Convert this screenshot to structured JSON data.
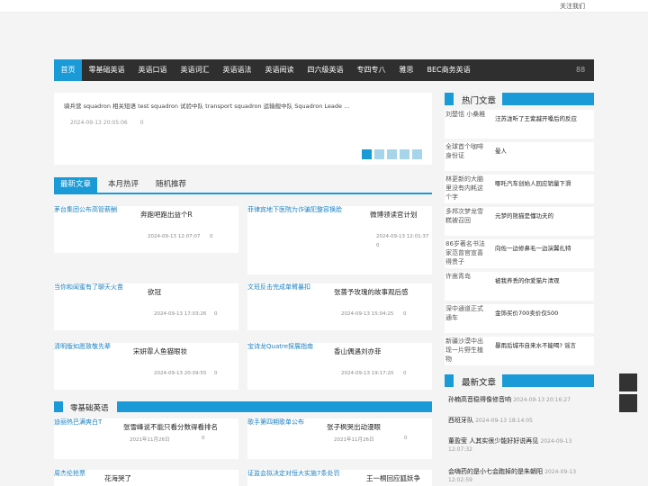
{
  "topbar": {
    "follow": "关注我们"
  },
  "nav": {
    "items": [
      "首页",
      "零基础英语",
      "英语口语",
      "英语词汇",
      "英语语法",
      "英语阅读",
      "四六级英语",
      "专四专八",
      "雅思",
      "BEC商务英语"
    ],
    "grid_icon": "88"
  },
  "slider": {
    "text": "骑兵营 squadron 相关短语 test squadron 试验中队 transport squadron 运输舰中队 Squadron Leade ...",
    "date": "2024-09-13 20:05:06",
    "count": "0"
  },
  "tabs": [
    "最新文章",
    "本月热评",
    "随机推荐"
  ],
  "cards": [
    {
      "img": "茅台集团公布高管薪酬",
      "title": "奔跑吧跑出益个R",
      "date": "2024-09-13 12:07:07",
      "count": "0"
    },
    {
      "img": "菲律宾地下医院为诈骗犯整容换脸",
      "title": "微博领读官计划",
      "date": "2024-09-13 12:01:37",
      "count": "0"
    },
    {
      "img": "当你和闺蜜有了聊天火苗",
      "title": "欲冠",
      "date": "2024-09-13 17:03:26",
      "count": "0"
    },
    {
      "img": "文班反击完成单臂暴扣",
      "title": "张蔷予玫瑰的故事观后感",
      "date": "2024-09-13 15:04:25",
      "count": "0"
    },
    {
      "img": "清明版如愿致敬先辈",
      "title": "宋妍霏人鱼猫眼妆",
      "date": "2024-09-13 20:09:55",
      "count": "0"
    },
    {
      "img": "宝诗龙Quatre探展指南",
      "title": "香山偶遇刘亦菲",
      "date": "2024-09-13 19:17:20",
      "count": "0"
    }
  ],
  "section": {
    "name": "零基础英语"
  },
  "section_cards": [
    {
      "img": "迪丽热巴满爽白T",
      "title": "张雪峰说不能只看分数得看排名",
      "date": "2021年11月26日",
      "count": "0"
    },
    {
      "img": "歌手第四期歌单公布",
      "title": "张子枫哭出动漫眼",
      "date": "2021年11月26日",
      "count": "0"
    },
    {
      "img": "周杰伦抢票",
      "title": "花海哭了",
      "date": "",
      "count": ""
    },
    {
      "img": "证监会拟决定对恒大实施7条处罚",
      "title": "王一桐回应狐妖争",
      "date": "",
      "count": ""
    }
  ],
  "hot_title": "热门文章",
  "hot": [
    {
      "img": "刘楚恬 小桑稚",
      "title": "汪苏泷听了王紫越开嗓后的反应"
    },
    {
      "img": "全球首个咖啡身份证",
      "title": "晕人"
    },
    {
      "img": "林更新的大脑里没有内耗这个字",
      "title": "哪吒汽车创始人回应销量下滑"
    },
    {
      "img": "多邦次梦龙雪糕被召回",
      "title": "元梦的熊猫是懂功夫的"
    },
    {
      "img": "86岁著名书法家范曾官宣喜得贵子",
      "title": "向佐一边修鼻毛一边演翼扎特"
    },
    {
      "img": "许嵩青岛",
      "title": "被我养丢的你爱猫片清观"
    },
    {
      "img": "深中通道正式通车",
      "title": "金饰买价700卖价仅500"
    },
    {
      "img": "新疆沙漠中出现一片野生植物",
      "title": "暴雨后城市自来水不能喝? 谣言"
    }
  ],
  "latest_title": "最新文章",
  "latest": [
    {
      "title": "孙楠高音稳得像修音响",
      "date": "2024-09-13 20:16:27"
    },
    {
      "title": "西班牙队",
      "date": "2024-09-13 18:14:05"
    },
    {
      "title": "董盈莹 人其实很少能好好说再见",
      "date": "2024-09-13 12:07:32"
    },
    {
      "title": "会嗨药的是小七会跑掉的是朱朝阳",
      "date": "2024-09-13 12:02:59"
    }
  ]
}
